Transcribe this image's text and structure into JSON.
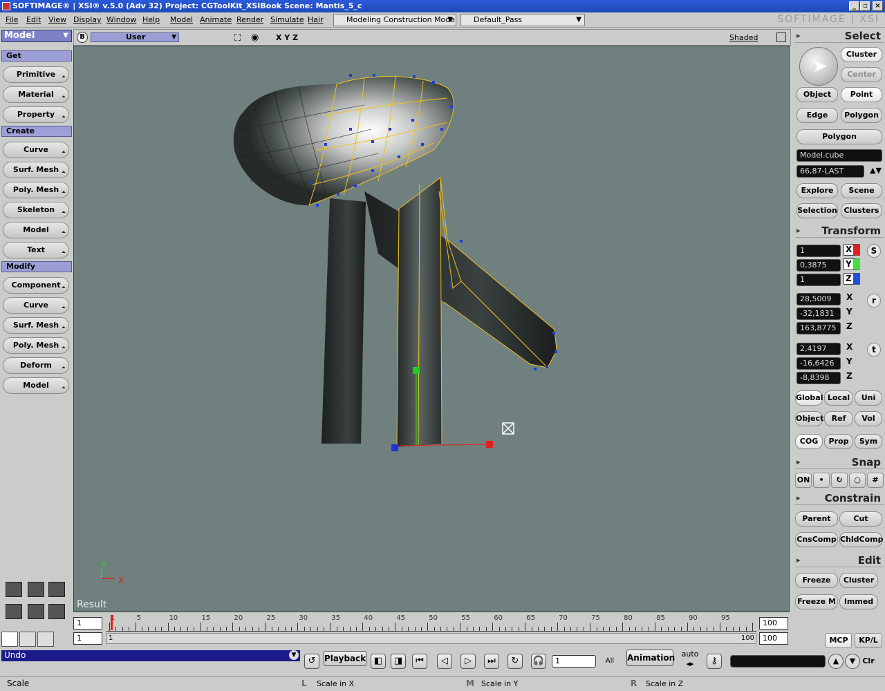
{
  "window": {
    "title": "SOFTIMAGE® | XSI® v.5.0 (Adv 32) Project: CGToolKit_XSIBook     Scene: Mantis_5_c",
    "brand": "SOFTIMAGE | XSI",
    "controls": [
      "_",
      "▫",
      "×"
    ]
  },
  "menu": {
    "items": [
      "File",
      "Edit",
      "View",
      "Display",
      "Window",
      "Help"
    ],
    "modules": [
      "Model",
      "Animate",
      "Render",
      "Simulate",
      "Hair"
    ],
    "construction_mode": "Modeling Construction Mode",
    "pass": "Default_Pass"
  },
  "left_panel": {
    "module": "Model",
    "sections": [
      {
        "title": "Get",
        "buttons": [
          "Primitive",
          "Material",
          "Property"
        ]
      },
      {
        "title": "Create",
        "buttons": [
          "Curve",
          "Surf. Mesh",
          "Poly. Mesh",
          "Skeleton",
          "Model",
          "Text"
        ]
      },
      {
        "title": "Modify",
        "buttons": [
          "Component",
          "Curve",
          "Surf. Mesh",
          "Poly. Mesh",
          "Deform",
          "Model"
        ]
      }
    ]
  },
  "viewport": {
    "camera": "User",
    "axes_toggle": "X Y Z",
    "display_mode": "Shaded",
    "result_label": "Result",
    "axis_y": "Y",
    "axis_x": "X",
    "b_label": "B",
    "colors": {
      "background": "#6f807e",
      "selection": "#f0c020"
    }
  },
  "timeline": {
    "start": "1",
    "start2": "1",
    "current": "1",
    "end": "100",
    "end2": "100",
    "range_end": "100",
    "ticks": [
      "1",
      "5",
      "10",
      "15",
      "20",
      "25",
      "30",
      "35",
      "40",
      "45",
      "50",
      "55",
      "60",
      "65",
      "70",
      "75",
      "80",
      "85",
      "90",
      "95"
    ]
  },
  "right_panel": {
    "select": {
      "title": "Select",
      "cluster": "Cluster",
      "center": "Center",
      "object": "Object",
      "point": "Point",
      "edge": "Edge",
      "polygon": "Polygon",
      "polygon2": "Polygon",
      "selection_name": "Model.cube",
      "selection_range": "66,87-LAST",
      "explore": "Explore",
      "scene": "Scene",
      "selection": "Selection",
      "clusters": "Clusters"
    },
    "transform": {
      "title": "Transform",
      "scale": [
        "1",
        "0,3875",
        "1"
      ],
      "rotate": [
        "28,5009",
        "-32,1831",
        "163,8775"
      ],
      "translate": [
        "2,4197",
        "-16,6426",
        "-8,8398"
      ],
      "x": "X",
      "y": "Y",
      "z": "Z",
      "s": "S",
      "r": "r",
      "t": "t",
      "global": "Global",
      "local": "Local",
      "uni": "Uni",
      "object": "Object",
      "ref": "Ref",
      "vol": "Vol",
      "cog": "COG",
      "prop": "Prop",
      "sym": "Sym"
    },
    "snap": {
      "title": "Snap",
      "on": "ON"
    },
    "constrain": {
      "title": "Constrain",
      "parent": "Parent",
      "cut": "Cut",
      "cnscomp": "CnsComp",
      "chldcomp": "ChldComp"
    },
    "edit": {
      "title": "Edit",
      "freeze": "Freeze",
      "cluster": "Cluster",
      "freeze_m": "Freeze M",
      "immed": "Immed"
    },
    "mcp": "MCP",
    "kpl": "KP/L"
  },
  "bottom": {
    "undo": "Undo",
    "playback": "Playback",
    "frame": "1",
    "all": "All",
    "animation": "Animation",
    "auto": "auto",
    "clr": "Clr"
  },
  "status": {
    "mode": "Scale",
    "l_key": "L",
    "l_label": "Scale in X",
    "m_key": "M",
    "m_label": "Scale in Y",
    "r_key": "R",
    "r_label": "Scale in Z"
  }
}
